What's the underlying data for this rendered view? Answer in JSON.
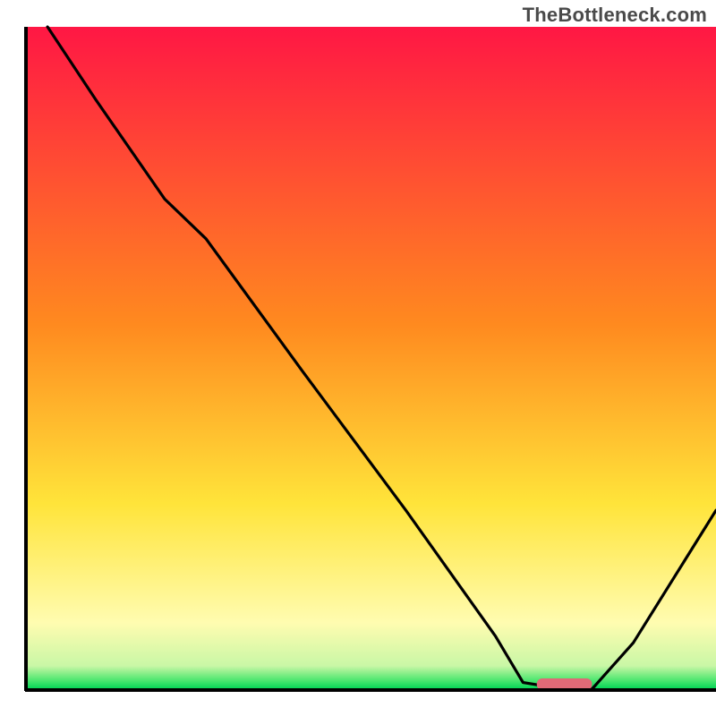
{
  "watermark": "TheBottleneck.com",
  "chart_data": {
    "type": "line",
    "title": "",
    "xlabel": "",
    "ylabel": "",
    "xlim": [
      0,
      100
    ],
    "ylim": [
      0,
      100
    ],
    "grid": false,
    "legend": false,
    "series": [
      {
        "name": "bottleneck-curve",
        "x": [
          3,
          10,
          20,
          26,
          40,
          55,
          68,
          72,
          78,
          82,
          88,
          100
        ],
        "y": [
          100,
          89,
          74,
          68,
          48,
          27,
          8,
          1,
          0,
          0,
          7,
          27
        ]
      }
    ],
    "marker": {
      "name": "optimal-zone",
      "x_range": [
        74,
        82
      ],
      "y": 0,
      "color": "#e06a77"
    },
    "gradient_stops": [
      {
        "pct": 0,
        "color": "#ff1744"
      },
      {
        "pct": 0.45,
        "color": "#ff8a1f"
      },
      {
        "pct": 0.72,
        "color": "#ffe43a"
      },
      {
        "pct": 0.9,
        "color": "#fffcb0"
      },
      {
        "pct": 0.965,
        "color": "#c9f7a6"
      },
      {
        "pct": 0.985,
        "color": "#56e873"
      },
      {
        "pct": 1.0,
        "color": "#00d455"
      }
    ]
  }
}
